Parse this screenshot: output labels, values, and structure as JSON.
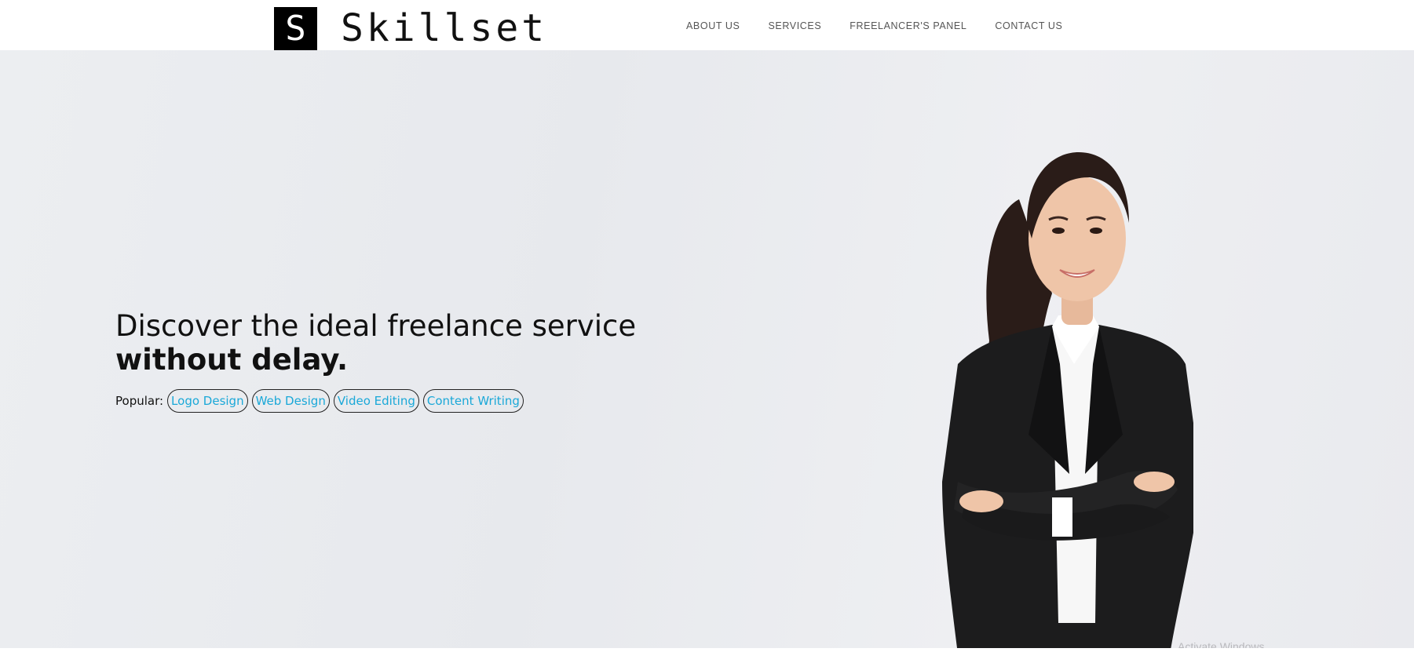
{
  "header": {
    "logo_mark": "S",
    "brand_name": "Skillset",
    "nav": [
      {
        "label": "ABOUT US"
      },
      {
        "label": "SERVICES"
      },
      {
        "label": "FREELANCER'S PANEL"
      },
      {
        "label": "CONTACT US"
      }
    ]
  },
  "hero": {
    "headline_line1": "Discover the ideal freelance service",
    "headline_line2": "without delay.",
    "popular_label": "Popular:",
    "popular_tags": [
      {
        "label": "Logo Design"
      },
      {
        "label": "Web Design"
      },
      {
        "label": "Video Editing"
      },
      {
        "label": "Content Writing"
      }
    ],
    "image_subject": "smiling woman in black business suit with arms crossed",
    "watermark": "Activate Windows"
  },
  "colors": {
    "accent": "#1aa8d8",
    "logo_bg": "#000000",
    "hero_bg": "#eaebee"
  }
}
